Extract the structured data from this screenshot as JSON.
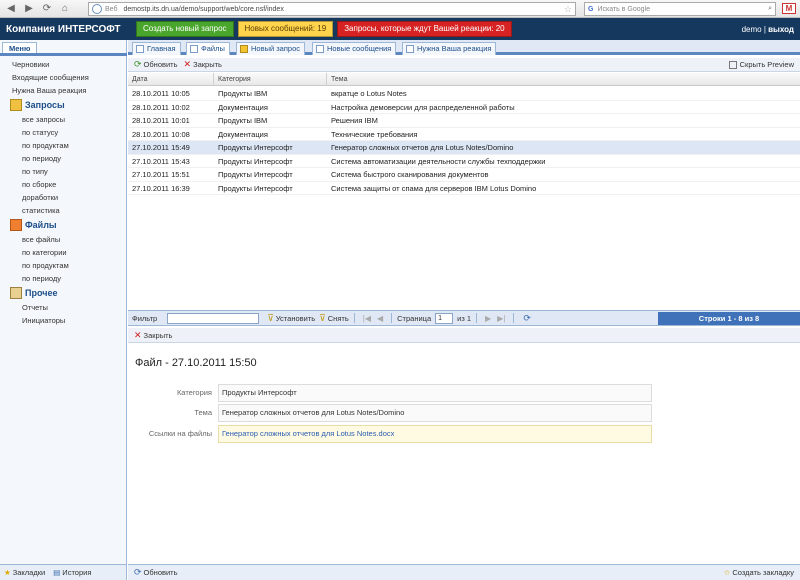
{
  "browser": {
    "address": "demostp.its.dn.ua/demo/support/web/core.nsf/index",
    "address_prefix": "Веб",
    "search_placeholder": "Искать в Google"
  },
  "header": {
    "company": "Компания ИНТЕРСОФТ",
    "new_request": "Создать новый запрос",
    "new_messages": "Новых сообщений: 19",
    "awaiting": "Запросы, которые ждут Вашей реакции: 20",
    "user": "demo",
    "separator": " | ",
    "logout": "выход",
    "colors": {
      "header_bg": "#15385f",
      "green": "#4aa52c",
      "yellow": "#ffd44d",
      "red": "#d62222"
    }
  },
  "sidebar": {
    "tab": "Меню",
    "top_items": [
      "Черновики",
      "Входящие сообщения",
      "Нужна Ваша реакция"
    ],
    "sections": [
      {
        "title": "Запросы",
        "icon": "requests-icon",
        "items": [
          "все запросы",
          "по статусу",
          "по продуктам",
          "по периоду",
          "по типу",
          "по сборке",
          "доработки",
          "статистика"
        ]
      },
      {
        "title": "Файлы",
        "icon": "files-icon",
        "items": [
          "все файлы",
          "по категории",
          "по продуктам",
          "по периоду"
        ]
      },
      {
        "title": "Прочее",
        "icon": "other-icon",
        "items": [
          "Отчеты",
          "Инициаторы"
        ]
      }
    ],
    "bottom": {
      "bookmarks": "Закладки",
      "history": "История"
    }
  },
  "tabs": [
    "Главная",
    "Файлы",
    "Новый запрос",
    "Новые сообщения",
    "Нужна Ваша реакция"
  ],
  "toolbar": {
    "refresh": "Обновить",
    "close": "Закрыть",
    "hide_preview": "Скрыть Preview"
  },
  "grid": {
    "columns": [
      "Дата",
      "Категория",
      "Тема"
    ],
    "rows": [
      {
        "date": "28.10.2011 10:05",
        "category": "Продукты IBM",
        "topic": "вкратце о Lotus Notes"
      },
      {
        "date": "28.10.2011 10:02",
        "category": "Документация",
        "topic": "Настройка демоверсии для распределенной работы"
      },
      {
        "date": "28.10.2011 10:01",
        "category": "Продукты IBM",
        "topic": "Решения IBM"
      },
      {
        "date": "28.10.2011 10:08",
        "category": "Документация",
        "topic": "Технические требования"
      },
      {
        "date": "27.10.2011 15:49",
        "category": "Продукты Интерсофт",
        "topic": "Генератор сложных отчетов для Lotus Notes/Domino"
      },
      {
        "date": "27.10.2011 15:43",
        "category": "Продукты Интерсофт",
        "topic": "Система автоматизации деятельности службы техподдержки"
      },
      {
        "date": "27.10.2011 15:51",
        "category": "Продукты Интерсофт",
        "topic": "Система быстрого сканирования документов"
      },
      {
        "date": "27.10.2011 16:39",
        "category": "Продукты Интерсофт",
        "topic": "Система защиты от спама для серверов IBM Lotus Domino"
      }
    ],
    "selected_index": 4
  },
  "pager": {
    "filter": "Фильтр",
    "set": "Установить",
    "reset": "Снять",
    "page": "Страница",
    "page_value": "1",
    "of": "из 1",
    "rows_info": "Строки 1 - 8 из 8"
  },
  "preview": {
    "close": "Закрыть",
    "title": "Файл - 27.10.2011 15:50",
    "fields": [
      {
        "label": "Категория",
        "value": "Продукты Интерсофт"
      },
      {
        "label": "Тема",
        "value": "Генератор сложных отчетов для Lotus Notes/Domino"
      },
      {
        "label": "Ссылки на файлы",
        "value": "Генератор сложных отчетов для Lotus Notes.docx"
      }
    ]
  },
  "footer": {
    "refresh": "Обновить",
    "bookmark": "Создать закладку"
  }
}
